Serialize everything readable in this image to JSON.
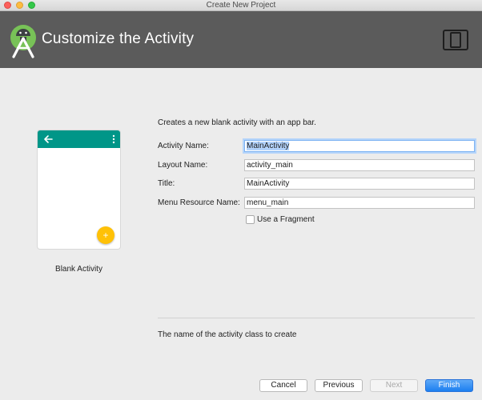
{
  "window": {
    "title": "Create New Project"
  },
  "header": {
    "title": "Customize the Activity",
    "logo_icon": "android-studio-icon",
    "device_icon": "phone-tablet-icon"
  },
  "template": {
    "label": "Blank Activity",
    "appbar_color": "#009688",
    "fab_color": "#ffc107",
    "fab_symbol": "+"
  },
  "form": {
    "description": "Creates a new blank activity with an app bar.",
    "activity_name": {
      "label": "Activity Name:",
      "value": "MainActivity"
    },
    "layout_name": {
      "label": "Layout Name:",
      "value": "activity_main"
    },
    "title": {
      "label": "Title:",
      "value": "MainActivity"
    },
    "menu_resource_name": {
      "label": "Menu Resource Name:",
      "value": "menu_main"
    },
    "use_fragment": {
      "label": "Use a Fragment",
      "checked": false
    },
    "hint": "The name of the activity class to create"
  },
  "buttons": {
    "cancel": "Cancel",
    "previous": "Previous",
    "next": "Next",
    "finish": "Finish"
  }
}
